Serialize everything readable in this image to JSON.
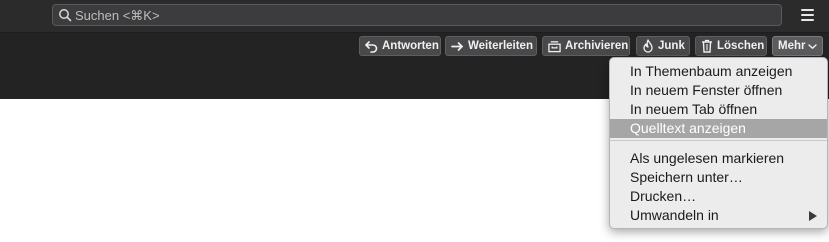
{
  "search": {
    "placeholder": "Suchen <⌘K>",
    "icon": "search-icon"
  },
  "menu_button": {
    "icon": "hamburger-menu-icon"
  },
  "toolbar": {
    "reply_label": "Antworten",
    "forward_label": "Weiterleiten",
    "archive_label": "Archivieren",
    "junk_label": "Junk",
    "delete_label": "Löschen",
    "more_label": "Mehr"
  },
  "more_menu": {
    "items": [
      {
        "label": "In Themenbaum anzeigen"
      },
      {
        "label": "In neuem Fenster öffnen"
      },
      {
        "label": "In neuem Tab öffnen"
      },
      {
        "label": "Quelltext anzeigen",
        "highlighted": true
      },
      {
        "label": "Als ungelesen markieren"
      },
      {
        "label": "Speichern unter…"
      },
      {
        "label": "Drucken…"
      },
      {
        "label": "Umwandeln in",
        "submenu": true
      }
    ]
  },
  "colors": {
    "toolbar_bg": "#232324",
    "button_bg": "#49494b",
    "menu_bg": "#ececec",
    "menu_highlight": "#a6a6a6"
  }
}
